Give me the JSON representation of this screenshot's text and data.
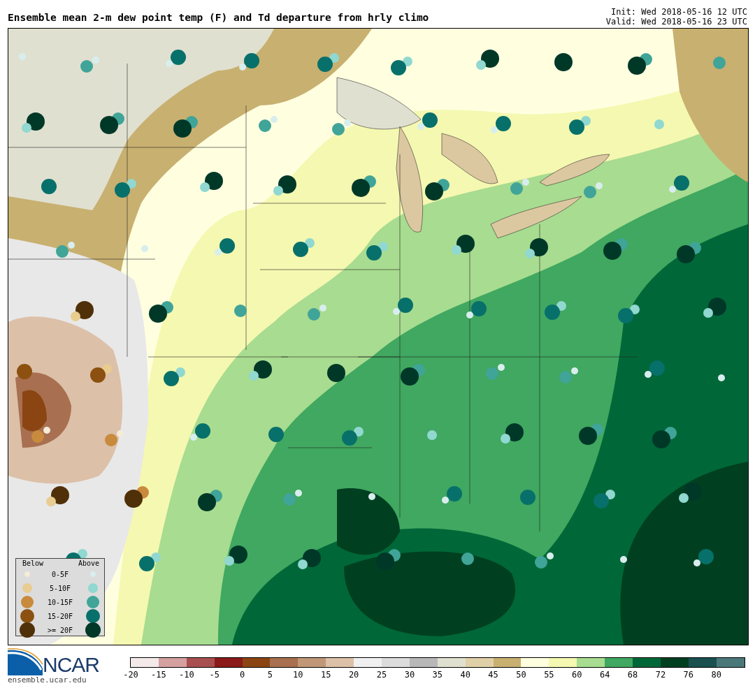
{
  "title": "Ensemble mean 2-m dew point temp (F) and Td departure from hrly climo",
  "init": "Init: Wed 2018-05-16 12 UTC",
  "valid": "Valid: Wed 2018-05-16 23 UTC",
  "legend": {
    "below_heading": "Below",
    "above_heading": "Above",
    "rows": [
      {
        "label": "0-5F",
        "below": {
          "color": "#f5ecd8"
        },
        "above": {
          "color": "#d8eeee"
        }
      },
      {
        "label": "5-10F",
        "below": {
          "color": "#e8cc90"
        },
        "above": {
          "color": "#90d8d0"
        }
      },
      {
        "label": "10-15F",
        "below": {
          "color": "#c88a3c"
        },
        "above": {
          "color": "#40a498"
        }
      },
      {
        "label": "15-20F",
        "below": {
          "color": "#8c5010"
        },
        "above": {
          "color": "#08706a"
        }
      },
      {
        "label": ">= 20F",
        "below": {
          "color": "#503008"
        },
        "above": {
          "color": "#003828"
        }
      }
    ]
  },
  "logo": {
    "text": "NCAR",
    "url": "ensemble.ucar.edu"
  },
  "colorbar": [
    {
      "label": "-20",
      "color": "#f5eaea"
    },
    {
      "label": "-15",
      "color": "#d4a0a0"
    },
    {
      "label": "-10",
      "color": "#a85050"
    },
    {
      "label": "-5",
      "color": "#8b1a1a"
    },
    {
      "label": "0",
      "color": "#8b4513"
    },
    {
      "label": "5",
      "color": "#a87050"
    },
    {
      "label": "10",
      "color": "#c09878"
    },
    {
      "label": "15",
      "color": "#dcc0a8"
    },
    {
      "label": "20",
      "color": "#f0f0f0"
    },
    {
      "label": "25",
      "color": "#dcdcdc"
    },
    {
      "label": "30",
      "color": "#b8b8b8"
    },
    {
      "label": "35",
      "color": "#e0e0d0"
    },
    {
      "label": "40",
      "color": "#e0d0a8"
    },
    {
      "label": "45",
      "color": "#c8b070"
    },
    {
      "label": "50",
      "color": "#ffffe0"
    },
    {
      "label": "55",
      "color": "#f5f8b0"
    },
    {
      "label": "60",
      "color": "#a8dc90"
    },
    {
      "label": "64",
      "color": "#40a860"
    },
    {
      "label": "68",
      "color": "#006838"
    },
    {
      "label": "72",
      "color": "#004020"
    },
    {
      "label": "76",
      "color": "#1a5050"
    },
    {
      "label": "80",
      "color": "#4a7878"
    }
  ]
}
